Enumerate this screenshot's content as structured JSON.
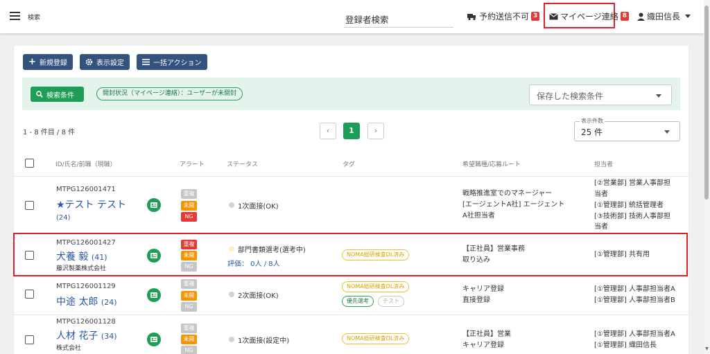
{
  "header": {
    "search_label": "検索",
    "registrant_search": "登録者検索",
    "send_fail_label": "予約送信不可",
    "send_fail_count": "3",
    "mypage_label": "マイページ連絡",
    "mypage_count": "8",
    "user_name": "織田信長"
  },
  "toolbar": {
    "new_label": "新規登録",
    "display_label": "表示設定",
    "bulk_label": "一括アクション"
  },
  "filter": {
    "search_button": "検索条件",
    "chip": "開封状況（マイページ連絡）：ユーザーが未開封",
    "saved_placeholder": "保存した検索条件"
  },
  "pagination": {
    "range": "1 - 8 件目 / 8 件",
    "prev": "‹",
    "current": "1",
    "next": "›",
    "per_page_label": "表示件数",
    "per_page_value": "25 件"
  },
  "table": {
    "headers": [
      "ID/氏名/前職（現職）",
      "アラート",
      "ステータス",
      "タグ",
      "希望職種/応募ルート",
      "担当者"
    ],
    "rows": [
      {
        "id": "MTPG126001471",
        "name": "★テスト テスト",
        "age": "(24)",
        "alerts": [
          "重複",
          "未開封",
          "NG"
        ],
        "status": "1次面接(OK)",
        "jobs": [
          "戦略推進室でのマネージャー",
          "[エージェントA社] エージェント",
          "A社担当者"
        ],
        "staff": [
          "[②営業部] 営業人事部担",
          "当者",
          "[①管理部] 統括管理者",
          "[③技術部] 技術人事部担",
          "当者"
        ]
      },
      {
        "id": "MTPG126001427",
        "name": "犬養 毅",
        "age": "(41)",
        "company": "藤沢製薬株式会社",
        "alerts": [
          "重複",
          "未開封",
          "NG"
        ],
        "status": "部門書類選考(選考中)",
        "evaluation": "評価： 0人 / 8人",
        "tags": [
          "NOMA総研検査DL済み"
        ],
        "jobs": [
          "【正社員】営業事務",
          "取り込み"
        ],
        "staff": [
          "[①管理部] 共有用"
        ]
      },
      {
        "id": "MTPG126001129",
        "name": "中途 太郎",
        "age": "(24)",
        "alerts": [
          "重複",
          "未開封",
          "NG"
        ],
        "status": "2次面接(OK)",
        "tags": [
          "NOMA総研検査DL済み",
          "優先選考",
          "テスト"
        ],
        "jobs": [
          "キャリア登録",
          "直接登録"
        ],
        "staff": [
          "[①管理部] 人事部担当者A",
          "[①管理部] 人事部担当者B"
        ]
      },
      {
        "id": "MTPG126001128",
        "name": "人材 花子",
        "age": "(34)",
        "company": "株式会社",
        "alerts": [
          "重複",
          "未開封",
          "NG"
        ],
        "status": "1次面接(設定中)",
        "tags": [
          "NOMA総研検査DL済み"
        ],
        "jobs": [
          "【正社員】営業",
          "キャリア登録"
        ],
        "staff": [
          "[①管理部] 人事部担当者A",
          "[①管理部] 織田信長"
        ]
      }
    ]
  },
  "colors": {
    "accent_green": "#1e9e54",
    "navy_button": "#33527e",
    "alert_red": "#e53935",
    "alert_orange": "#f59300",
    "alert_grey": "#c6c6c6",
    "link_blue": "#2d56a3",
    "highlight_red": "#e0212a"
  }
}
